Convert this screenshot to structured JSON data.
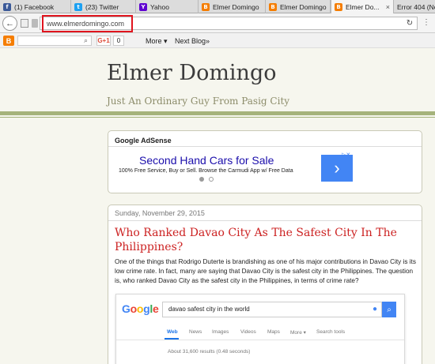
{
  "browser": {
    "tabs": [
      {
        "label": "(1) Facebook",
        "favicon": "facebook-icon",
        "color": "#3b5998",
        "glyph": "f"
      },
      {
        "label": "(23) Twitter",
        "favicon": "twitter-icon",
        "color": "#1da1f2",
        "glyph": "t"
      },
      {
        "label": "Yahoo",
        "favicon": "yahoo-icon",
        "color": "#5f01d1",
        "glyph": "Y"
      },
      {
        "label": "Elmer Domingo",
        "favicon": "blogger-icon",
        "color": "#f57d00",
        "glyph": "B"
      },
      {
        "label": "Elmer Domingo",
        "favicon": "blogger-icon",
        "color": "#f57d00",
        "glyph": "B"
      },
      {
        "label": "Elmer Do...",
        "favicon": "blogger-icon",
        "color": "#f57d00",
        "glyph": "B",
        "active": true
      },
      {
        "label": "Error 404 (No",
        "favicon": "",
        "color": "",
        "glyph": ""
      }
    ],
    "close_glyph": "×",
    "url": "www.elmerdomingo.com",
    "reload_glyph": "↻",
    "back_glyph": "←"
  },
  "blogger_bar": {
    "logo_glyph": "B",
    "gplus_label": "G+1",
    "gplus_count": "0",
    "more_label": "More ▾",
    "next_blog_label": "Next Blog»"
  },
  "blog": {
    "title": "Elmer Domingo",
    "description": "Just An Ordinary Guy From Pasig City"
  },
  "adsense": {
    "title": "Google AdSense",
    "headline": "Second Hand Cars for Sale",
    "body": "100% Free Service, Buy or Sell. Browse the Carmudi App w/ Free Data",
    "arrow_glyph": "›",
    "choices_glyph": "▷✕"
  },
  "post": {
    "date": "Sunday, November 29, 2015",
    "title": "Who Ranked Davao City As The Safest City In The Philippines?",
    "body": "One of the things that Rodrigo Duterte is brandishing as one of his major contributions in Davao City is its low crime rate. In fact, many are saying that Davao City is the safest city in the Philippines. The question is, who ranked Davao City as the safest city in the Philippines, in terms of crime rate?"
  },
  "google_shot": {
    "logo_letters": [
      {
        "ch": "G",
        "color": "#4285f4"
      },
      {
        "ch": "o",
        "color": "#ea4335"
      },
      {
        "ch": "o",
        "color": "#fbbc05"
      },
      {
        "ch": "g",
        "color": "#4285f4"
      },
      {
        "ch": "l",
        "color": "#34a853"
      },
      {
        "ch": "e",
        "color": "#ea4335"
      }
    ],
    "query": "davao safest city in the world",
    "mic_glyph": "🎤",
    "search_glyph": "⌕",
    "tabs": [
      "Web",
      "News",
      "Images",
      "Videos",
      "Maps",
      "More ▾",
      "Search tools"
    ],
    "stats": "About 31,600 results (0.48 seconds)"
  }
}
